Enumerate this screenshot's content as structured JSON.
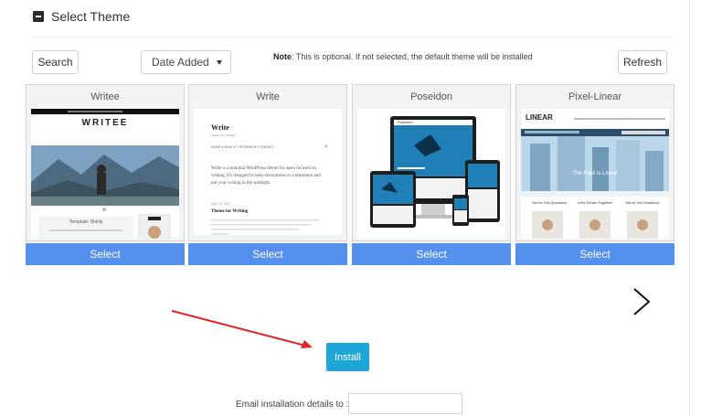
{
  "section": {
    "title": "Select Theme"
  },
  "toolbar": {
    "search_label": "Search",
    "sort_value": "Date Added",
    "note_label": "Note",
    "note_text": ": This is optional. If not selected, the default theme will be installed",
    "refresh_label": "Refresh"
  },
  "themes": [
    {
      "name": "Writee",
      "select_label": "Select",
      "preview_brand": "WRITEE",
      "preview_caption": "Template: Shinly"
    },
    {
      "name": "Write",
      "select_label": "Select",
      "preview_brand": "Write",
      "preview_tagline": "Theme for Writing",
      "preview_nav": "HOME ▾   PAGE ▾   TYPOGRAPHY   CONTACT",
      "preview_body": "Write is a minimal WordPress theme for users focused on writing. It's designed to keep decorations to a minimum and put your writing in the spotlight.",
      "preview_post_date": "April 10, 2017",
      "preview_post_title": "Theme for Writing"
    },
    {
      "name": "Poseidon",
      "select_label": "Select",
      "preview_brand": "Poseidon"
    },
    {
      "name": "Pixel-Linear",
      "select_label": "Select",
      "preview_brand": "LINEAR",
      "preview_hero": "The Pixel is Linear",
      "preview_cols": [
        "You've Got Questions",
        "Let's Dream Together",
        "We've Got Solutions!"
      ]
    }
  ],
  "install": {
    "label": "Install"
  },
  "email": {
    "label": "Email installation details to :",
    "value": ""
  },
  "colors": {
    "select_button": "#5590ec",
    "install_button": "#1ea6d6",
    "annotation_arrow": "#e3262a"
  },
  "icons": {
    "next": "chevron-right-icon",
    "collapse": "minus-square-icon",
    "sort_caret": "caret-down-icon"
  }
}
